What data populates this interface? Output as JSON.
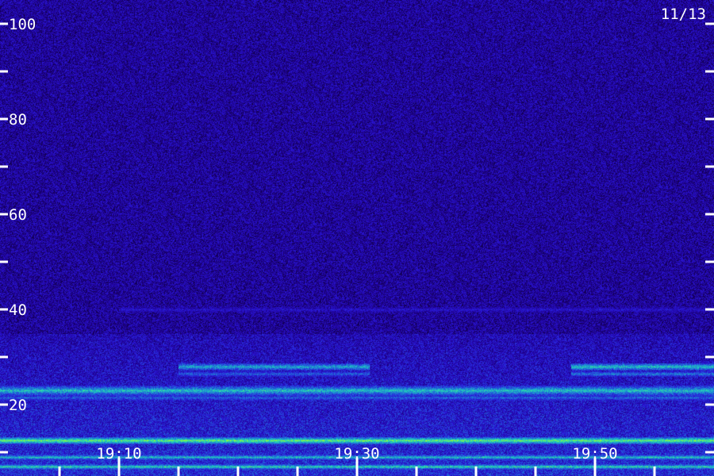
{
  "chart_data": {
    "type": "heatmap",
    "title": "",
    "date_label": "11/13",
    "xlabel": "",
    "ylabel": "",
    "y_ticks": [
      {
        "value": 100,
        "label": "100"
      },
      {
        "value": 80,
        "label": "80"
      },
      {
        "value": 60,
        "label": "60"
      },
      {
        "value": 40,
        "label": "40"
      },
      {
        "value": 20,
        "label": "20"
      }
    ],
    "y_minor_ticks": [
      90,
      70,
      50,
      30,
      10
    ],
    "x_ticks": [
      {
        "minute": 10,
        "label": "19:10"
      },
      {
        "minute": 30,
        "label": "19:30"
      },
      {
        "minute": 50,
        "label": "19:50"
      }
    ],
    "x_minor_minutes": [
      5,
      15,
      20,
      25,
      35,
      40,
      45,
      55
    ],
    "xlim_minutes": [
      0,
      60
    ],
    "ylim": [
      0,
      105
    ],
    "palette": [
      "#080018",
      "#1e008e",
      "#2a18d8",
      "#1f7ad8",
      "#20d8b8",
      "#a8ff20"
    ],
    "bands": [
      {
        "y": 40,
        "width": 0.5,
        "strength": 0.35,
        "t_start": 10,
        "t_end": 60
      },
      {
        "y": 28,
        "width": 0.8,
        "strength": 0.7,
        "t_start": 15,
        "t_end": 31
      },
      {
        "y": 28,
        "width": 0.8,
        "strength": 0.75,
        "t_start": 48,
        "t_end": 60
      },
      {
        "y": 26.5,
        "width": 0.6,
        "strength": 0.55,
        "t_start": 15,
        "t_end": 31
      },
      {
        "y": 26.5,
        "width": 0.6,
        "strength": 0.6,
        "t_start": 48,
        "t_end": 60
      },
      {
        "y": 23,
        "width": 1.0,
        "strength": 0.75,
        "t_start": 0,
        "t_end": 60
      },
      {
        "y": 21.5,
        "width": 0.6,
        "strength": 0.55,
        "t_start": 0,
        "t_end": 60
      },
      {
        "y": 12.5,
        "width": 0.7,
        "strength": 0.9,
        "t_start": 0,
        "t_end": 60
      },
      {
        "y": 9,
        "width": 0.5,
        "strength": 0.75,
        "t_start": 0,
        "t_end": 60
      },
      {
        "y": 7,
        "width": 0.5,
        "strength": 0.8,
        "t_start": 0,
        "t_end": 60
      },
      {
        "y": 2.5,
        "width": 0.6,
        "strength": 0.85,
        "t_start": 0,
        "t_end": 60
      },
      {
        "y": 1,
        "width": 0.5,
        "strength": 0.7,
        "t_start": 0,
        "t_end": 60
      }
    ]
  }
}
